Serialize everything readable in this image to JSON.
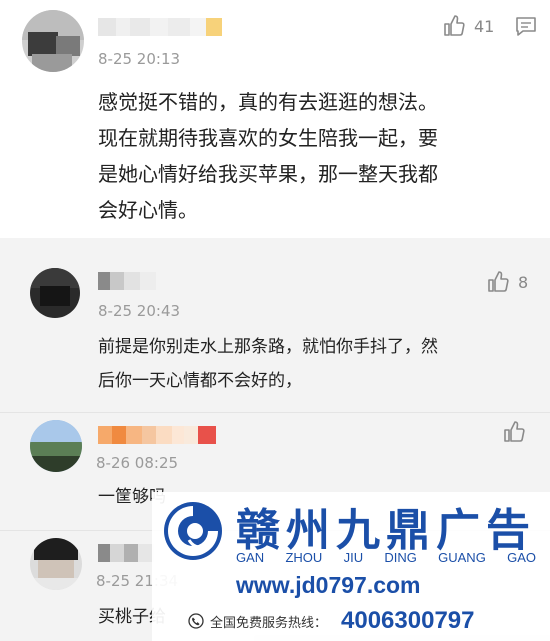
{
  "main_comment": {
    "time": "8-25 20:13",
    "text_lines": [
      "感觉挺不错的，真的有去逛逛的想法。",
      "现在就期待我喜欢的女生陪我一起，要",
      "是她心情好给我买苹果，那一整天我都",
      "会好心情。"
    ],
    "like_count": "41",
    "like_icon": "thumbs-up-icon",
    "reply_icon": "comment-bubble-icon"
  },
  "replies": [
    {
      "time": "8-25 20:43",
      "text_lines": [
        "前提是你别走水上那条路，就怕你手抖了，然",
        "后你一天心情都不会好的，"
      ],
      "like_count": "8"
    },
    {
      "time": "8-26 08:25",
      "text_lines": [
        "一筐够吗"
      ],
      "like_count": ""
    },
    {
      "time": "8-25 21:34",
      "text_lines": [
        "买桃子给"
      ],
      "like_count": ""
    }
  ],
  "ad": {
    "title": "赣州九鼎广告",
    "pinyin": [
      "GAN",
      "ZHOU",
      "JIU",
      "DING",
      "GUANG",
      "GAO"
    ],
    "url": "www.jd0797.com",
    "hotline_label": "全国免费服务热线：",
    "phone": "4006300797",
    "brand_color": "#1b4fa8"
  }
}
